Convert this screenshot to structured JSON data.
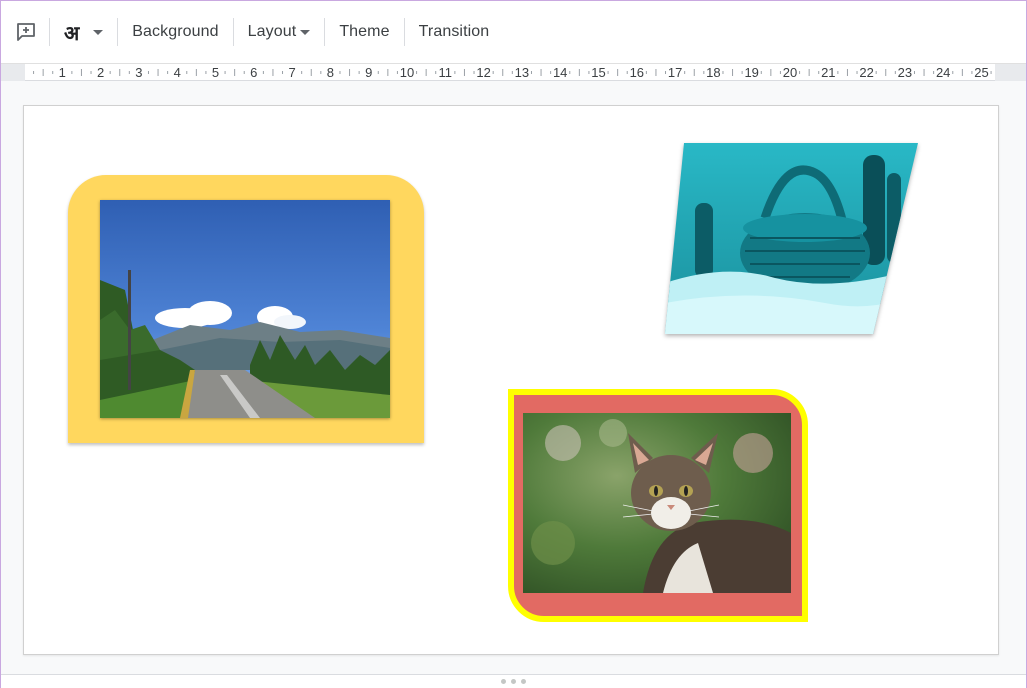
{
  "toolbar": {
    "new_comment_icon": "comment-add-icon",
    "input_tools_glyph": "अ",
    "background_label": "Background",
    "layout_label": "Layout",
    "theme_label": "Theme",
    "transition_label": "Transition"
  },
  "ruler": {
    "numbers": [
      "1",
      "2",
      "3",
      "4",
      "5",
      "6",
      "7",
      "8",
      "9",
      "10",
      "11",
      "12",
      "13",
      "14",
      "15",
      "16",
      "17",
      "18",
      "19",
      "20",
      "21",
      "22",
      "23",
      "24",
      "25"
    ]
  },
  "slide": {
    "images": [
      {
        "name": "landscape-road-photo",
        "frame_color": "#ffd75e"
      },
      {
        "name": "basket-snow-photo",
        "tint": "#3fd0dc"
      },
      {
        "name": "cat-photo",
        "border_color": "#ffff00",
        "frame_color": "#e26a63"
      }
    ]
  },
  "colors": {
    "accent_yellow": "#ffd75e",
    "highlight_yellow": "#ffff00",
    "salmon": "#e26a63",
    "cyan_tint": "#3fd0dc"
  }
}
